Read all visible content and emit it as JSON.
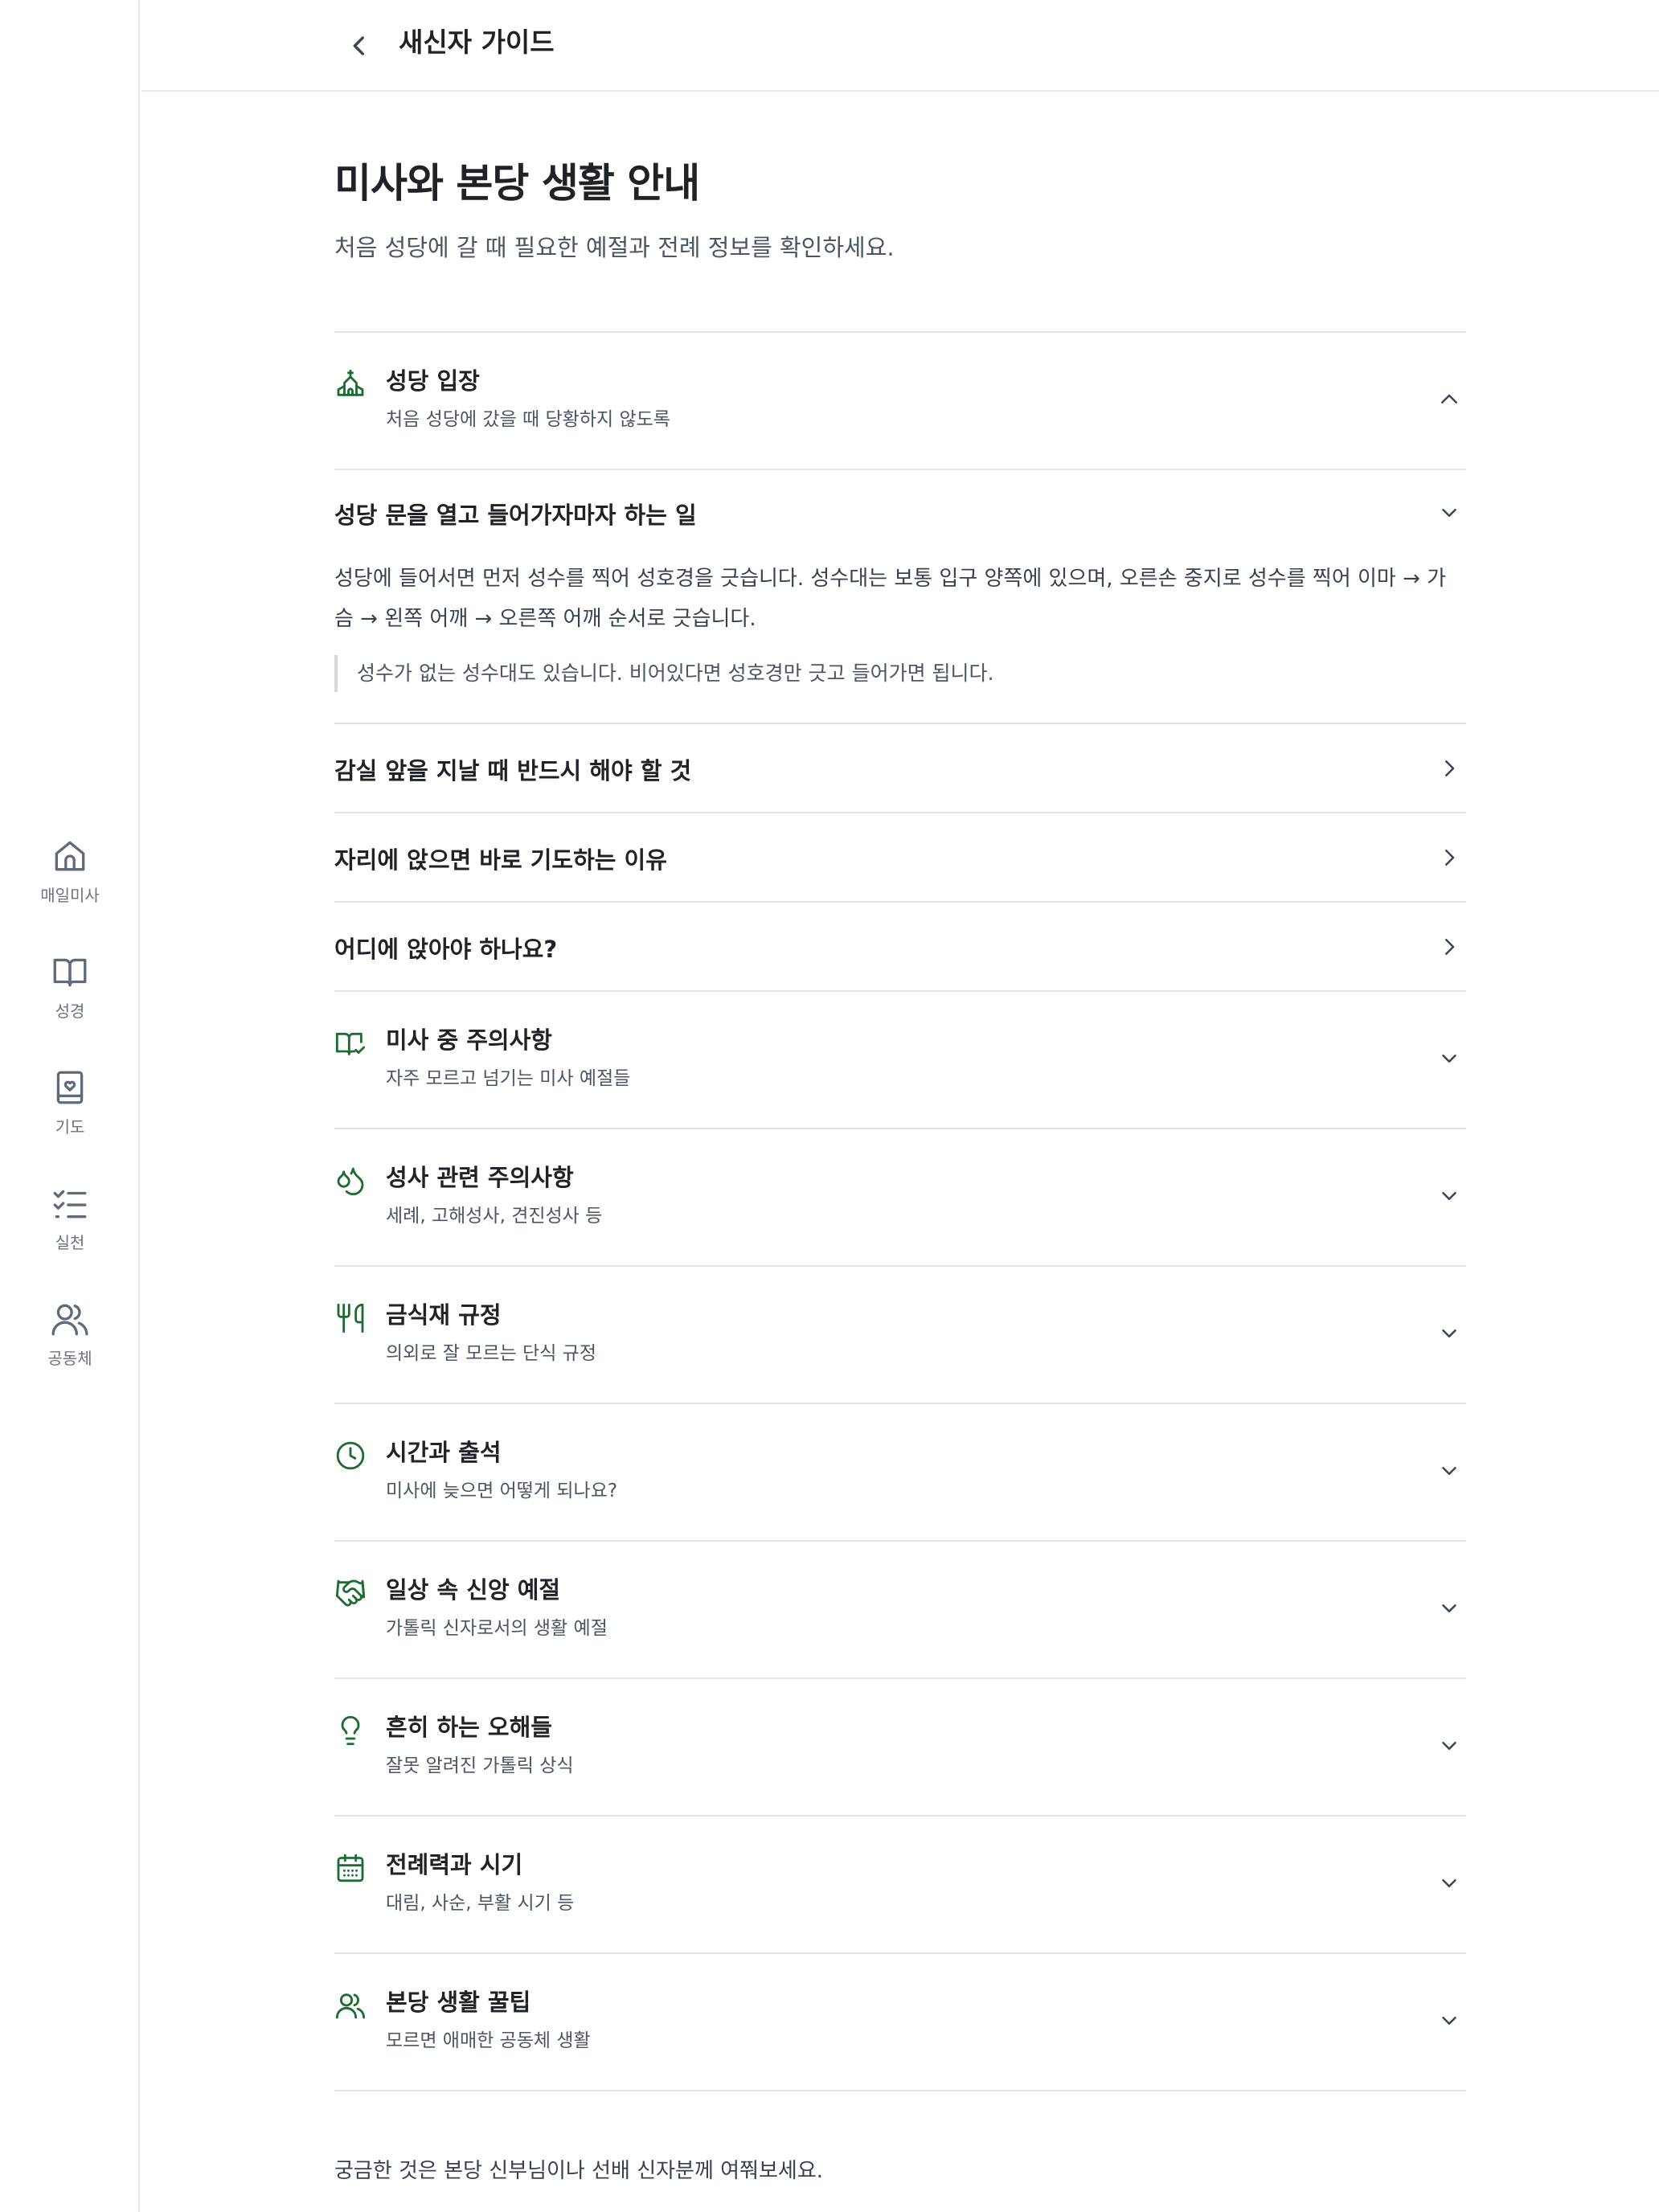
{
  "header": {
    "title": "새신자 가이드"
  },
  "page": {
    "title": "미사와 본당 생활 안내",
    "subtitle": "처음 성당에 갈 때 필요한 예절과 전례 정보를 확인하세요."
  },
  "sidebar": {
    "items": [
      {
        "label": "매일미사",
        "icon": "home-icon"
      },
      {
        "label": "성경",
        "icon": "book-icon"
      },
      {
        "label": "기도",
        "icon": "prayer-book-icon"
      },
      {
        "label": "실천",
        "icon": "checklist-icon"
      },
      {
        "label": "공동체",
        "icon": "users-icon"
      }
    ]
  },
  "sections": {
    "entry": {
      "title": "성당 입장",
      "desc": "처음 성당에 갔을 때 당황하지 않도록",
      "icon": "church-icon",
      "expanded": true,
      "subs": [
        {
          "title": "성당 문을 열고 들어가자마자 하는 일",
          "body": "성당에 들어서면 먼저 성수를 찍어 성호경을 긋습니다. 성수대는 보통 입구 양쪽에 있으며, 오른손 중지로 성수를 찍어 이마 → 가슴 → 왼쪽 어깨 → 오른쪽 어깨 순서로 긋습니다.",
          "note": "성수가 없는 성수대도 있습니다. 비어있다면 성호경만 긋고 들어가면 됩니다."
        },
        {
          "title": "감실 앞을 지날 때 반드시 해야 할 것"
        },
        {
          "title": "자리에 앉으면 바로 기도하는 이유"
        },
        {
          "title": "어디에 앉아야 하나요?"
        }
      ]
    },
    "others": [
      {
        "title": "미사 중 주의사항",
        "desc": "자주 모르고 넘기는 미사 예절들",
        "icon": "book-check-icon"
      },
      {
        "title": "성사 관련 주의사항",
        "desc": "세례, 고해성사, 견진성사 등",
        "icon": "droplets-icon"
      },
      {
        "title": "금식재 규정",
        "desc": "의외로 잘 모르는 단식 규정",
        "icon": "utensils-icon"
      },
      {
        "title": "시간과 출석",
        "desc": "미사에 늦으면 어떻게 되나요?",
        "icon": "clock-icon"
      },
      {
        "title": "일상 속 신앙 예절",
        "desc": "가톨릭 신자로서의 생활 예절",
        "icon": "handshake-icon"
      },
      {
        "title": "흔히 하는 오해들",
        "desc": "잘못 알려진 가톨릭 상식",
        "icon": "lightbulb-icon"
      },
      {
        "title": "전례력과 시기",
        "desc": "대림, 사순, 부활 시기 등",
        "icon": "calendar-icon"
      },
      {
        "title": "본당 생활 꿀팁",
        "desc": "모르면 애매한 공동체 생활",
        "icon": "users-icon"
      }
    ]
  },
  "footer": {
    "note": "궁금한 것은 본당 신부님이나 선배 신자분께 여쭤보세요."
  },
  "colors": {
    "accent": "#1e6b34",
    "nav_icon": "#5f6b7a",
    "text": "#1f2328",
    "muted": "#4b5563",
    "divider": "#e3e5e8"
  }
}
